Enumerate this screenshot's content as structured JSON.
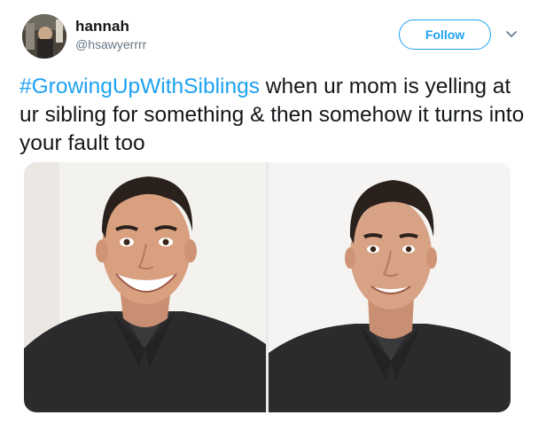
{
  "author": {
    "display_name": "hannah",
    "handle": "@hsawyerrrr",
    "avatar_icon": "avatar-photo"
  },
  "actions": {
    "follow_label": "Follow",
    "more_icon": "chevron-down-icon"
  },
  "tweet": {
    "hashtag": "#GrowingUpWithSiblings",
    "body": " when ur mom is yelling at ur sibling for something & then somehow it turns into your fault too"
  },
  "media": {
    "photos": [
      {
        "name": "photo-exaggerated-smile"
      },
      {
        "name": "photo-forced-smile"
      }
    ]
  },
  "colors": {
    "accent": "#1da1f2",
    "text": "#14171a",
    "secondary": "#657786"
  }
}
